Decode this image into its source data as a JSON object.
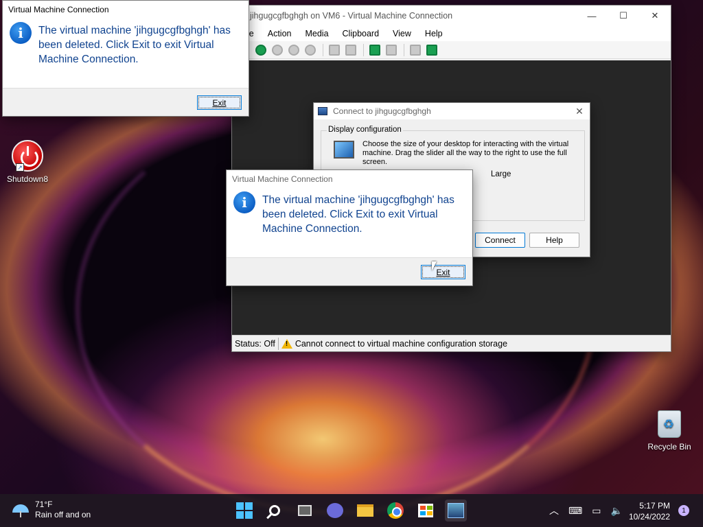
{
  "desktop": {
    "icons": [
      {
        "label": "Shutdown8",
        "icon": "power-icon"
      },
      {
        "label": "Recycle Bin",
        "icon": "recycle-bin-icon"
      }
    ]
  },
  "vm_window": {
    "title": "jihgugcgfbghgh on VM6 - Virtual Machine Connection",
    "menu": [
      "le",
      "Action",
      "Media",
      "Clipboard",
      "View",
      "Help"
    ],
    "status_label": "Status: Off",
    "status_message": "Cannot connect to virtual machine configuration storage"
  },
  "connect_dialog": {
    "title": "Connect to jihgugcgfbghgh",
    "group_label": "Display configuration",
    "description": "Choose the size of your desktop for interacting with the virtual machine. Drag the slider all the way to the right to use the full screen.",
    "slider_label": "Large",
    "connect_label": "Connect",
    "help_label": "Help"
  },
  "message_dialog_1": {
    "title": "Virtual Machine Connection",
    "message": "The virtual machine 'jihgugcgfbghgh' has been deleted. Click Exit to exit Virtual Machine Connection.",
    "exit_label": "Exit"
  },
  "message_dialog_2": {
    "title": "Virtual Machine Connection",
    "message": "The virtual machine 'jihgugcgfbghgh' has been deleted. Click Exit to exit Virtual Machine Connection.",
    "exit_label": "Exit"
  },
  "taskbar": {
    "weather_temp": "71°F",
    "weather_desc": "Rain off and on",
    "time": "5:17 PM",
    "date": "10/24/2022",
    "notification_count": "1"
  },
  "colors": {
    "accent": "#0078d4",
    "message_text": "#10438f",
    "info_icon": "#0a5cc2"
  }
}
